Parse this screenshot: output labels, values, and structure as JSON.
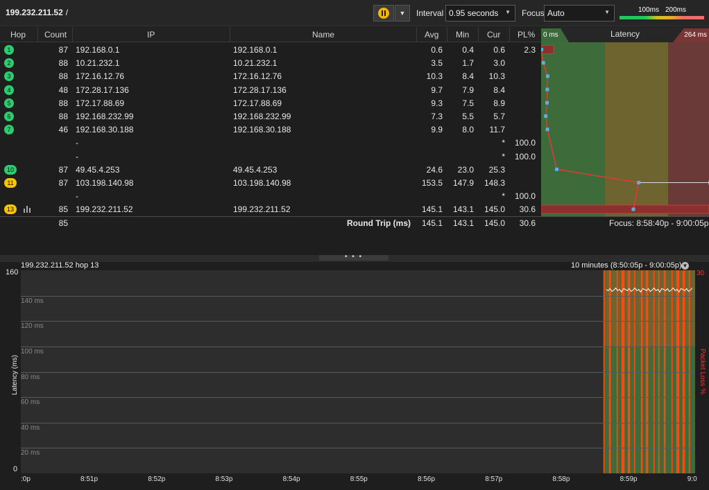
{
  "toolbar": {
    "target": "199.232.211.52",
    "target_suffix": "/",
    "interval_label": "Interval",
    "interval_value": "0.95 seconds",
    "focus_label": "Focus",
    "focus_value": "Auto",
    "legend_low": "100ms",
    "legend_high": "200ms"
  },
  "table": {
    "headers": {
      "hop": "Hop",
      "count": "Count",
      "ip": "IP",
      "name": "Name",
      "avg": "Avg",
      "min": "Min",
      "cur": "Cur",
      "pl": "PL%"
    },
    "rows": [
      {
        "hop": "1",
        "count": "87",
        "ip": "192.168.0.1",
        "name": "192.168.0.1",
        "avg": "0.6",
        "min": "0.4",
        "cur": "0.6",
        "pl": "2.3",
        "color": "green"
      },
      {
        "hop": "2",
        "count": "88",
        "ip": "10.21.232.1",
        "name": "10.21.232.1",
        "avg": "3.5",
        "min": "1.7",
        "cur": "3.0",
        "pl": "",
        "color": "green"
      },
      {
        "hop": "3",
        "count": "88",
        "ip": "172.16.12.76",
        "name": "172.16.12.76",
        "avg": "10.3",
        "min": "8.4",
        "cur": "10.3",
        "pl": "",
        "color": "green"
      },
      {
        "hop": "4",
        "count": "48",
        "ip": "172.28.17.136",
        "name": "172.28.17.136",
        "avg": "9.7",
        "min": "7.9",
        "cur": "8.4",
        "pl": "",
        "color": "green"
      },
      {
        "hop": "5",
        "count": "88",
        "ip": "172.17.88.69",
        "name": "172.17.88.69",
        "avg": "9.3",
        "min": "7.5",
        "cur": "8.9",
        "pl": "",
        "color": "green"
      },
      {
        "hop": "6",
        "count": "88",
        "ip": "192.168.232.99",
        "name": "192.168.232.99",
        "avg": "7.3",
        "min": "5.5",
        "cur": "5.7",
        "pl": "",
        "color": "green"
      },
      {
        "hop": "7",
        "count": "46",
        "ip": "192.168.30.188",
        "name": "192.168.30.188",
        "avg": "9.9",
        "min": "8.0",
        "cur": "11.7",
        "pl": "",
        "color": "green"
      },
      {
        "hop": "",
        "count": "",
        "ip": "-",
        "name": "",
        "avg": "",
        "min": "",
        "cur": "*",
        "pl": "100.0",
        "color": ""
      },
      {
        "hop": "",
        "count": "",
        "ip": "-",
        "name": "",
        "avg": "",
        "min": "",
        "cur": "*",
        "pl": "100.0",
        "color": ""
      },
      {
        "hop": "10",
        "count": "87",
        "ip": "49.45.4.253",
        "name": "49.45.4.253",
        "avg": "24.6",
        "min": "23.0",
        "cur": "25.3",
        "pl": "",
        "color": "green"
      },
      {
        "hop": "11",
        "count": "87",
        "ip": "103.198.140.98",
        "name": "103.198.140.98",
        "avg": "153.5",
        "min": "147.9",
        "cur": "148.3",
        "pl": "",
        "color": "yellow"
      },
      {
        "hop": "",
        "count": "",
        "ip": "-",
        "name": "",
        "avg": "",
        "min": "",
        "cur": "*",
        "pl": "100.0",
        "color": ""
      },
      {
        "hop": "13",
        "count": "85",
        "ip": "199.232.211.52",
        "name": "199.232.211.52",
        "avg": "145.1",
        "min": "143.1",
        "cur": "145.0",
        "pl": "30.6",
        "color": "yellow"
      }
    ],
    "totals": {
      "count": "85",
      "label": "Round Trip (ms)",
      "avg": "145.1",
      "min": "143.1",
      "cur": "145.0",
      "pl": "30.6",
      "focus": "Focus: 8:58:40p - 9:00:05p"
    }
  },
  "latency_panel": {
    "title": "Latency",
    "min_label": "0 ms",
    "max_label": "264 ms",
    "max_ms": 264,
    "zones": [
      {
        "upto_ms": 100,
        "color": "#3d6b3a"
      },
      {
        "upto_ms": 200,
        "color": "#6e6430"
      },
      {
        "upto_ms": 264,
        "color": "#6a3a38"
      }
    ],
    "hops": [
      {
        "avg": 0.6,
        "min": 0.4,
        "max": 2.0,
        "pl": 2.3
      },
      {
        "avg": 3.5,
        "min": 1.7,
        "max": 5.0,
        "pl": 0
      },
      {
        "avg": 10.3,
        "min": 8.4,
        "max": 12.0,
        "pl": 0
      },
      {
        "avg": 9.7,
        "min": 7.9,
        "max": 11.0,
        "pl": 0
      },
      {
        "avg": 9.3,
        "min": 7.5,
        "max": 11.0,
        "pl": 0
      },
      {
        "avg": 7.3,
        "min": 5.5,
        "max": 9.0,
        "pl": 0
      },
      {
        "avg": 9.9,
        "min": 8.0,
        "max": 12.0,
        "pl": 0
      },
      null,
      null,
      {
        "avg": 24.6,
        "min": 23.0,
        "max": 26.0,
        "pl": 0
      },
      {
        "avg": 153.5,
        "min": 147.9,
        "max": 264.0,
        "pl": 0
      },
      null,
      {
        "avg": 145.1,
        "min": 143.1,
        "max": 147.0,
        "pl": 30.6
      }
    ]
  },
  "history": {
    "title": "199.232.211.52 hop 13",
    "range": "10 minutes (8:50:05p - 9:00:05p)",
    "ylabel": "Latency (ms)",
    "y2label": "Packet Loss %",
    "y2max": "30",
    "ymax": "160",
    "ymin": "0",
    "ymax_val": 160,
    "gridlines": [
      "140 ms",
      "120 ms",
      "100 ms",
      "80 ms",
      "60 ms",
      "40 ms",
      "20 ms"
    ],
    "grid_values": [
      140,
      120,
      100,
      80,
      60,
      40,
      20
    ],
    "xticks": [
      ":0p",
      "8:51p",
      "8:52p",
      "8:53p",
      "8:54p",
      "8:55p",
      "8:56p",
      "8:57p",
      "8:58p",
      "8:59p",
      "9:0"
    ],
    "data_start_fraction": 0.864,
    "latency_level": 145
  }
}
